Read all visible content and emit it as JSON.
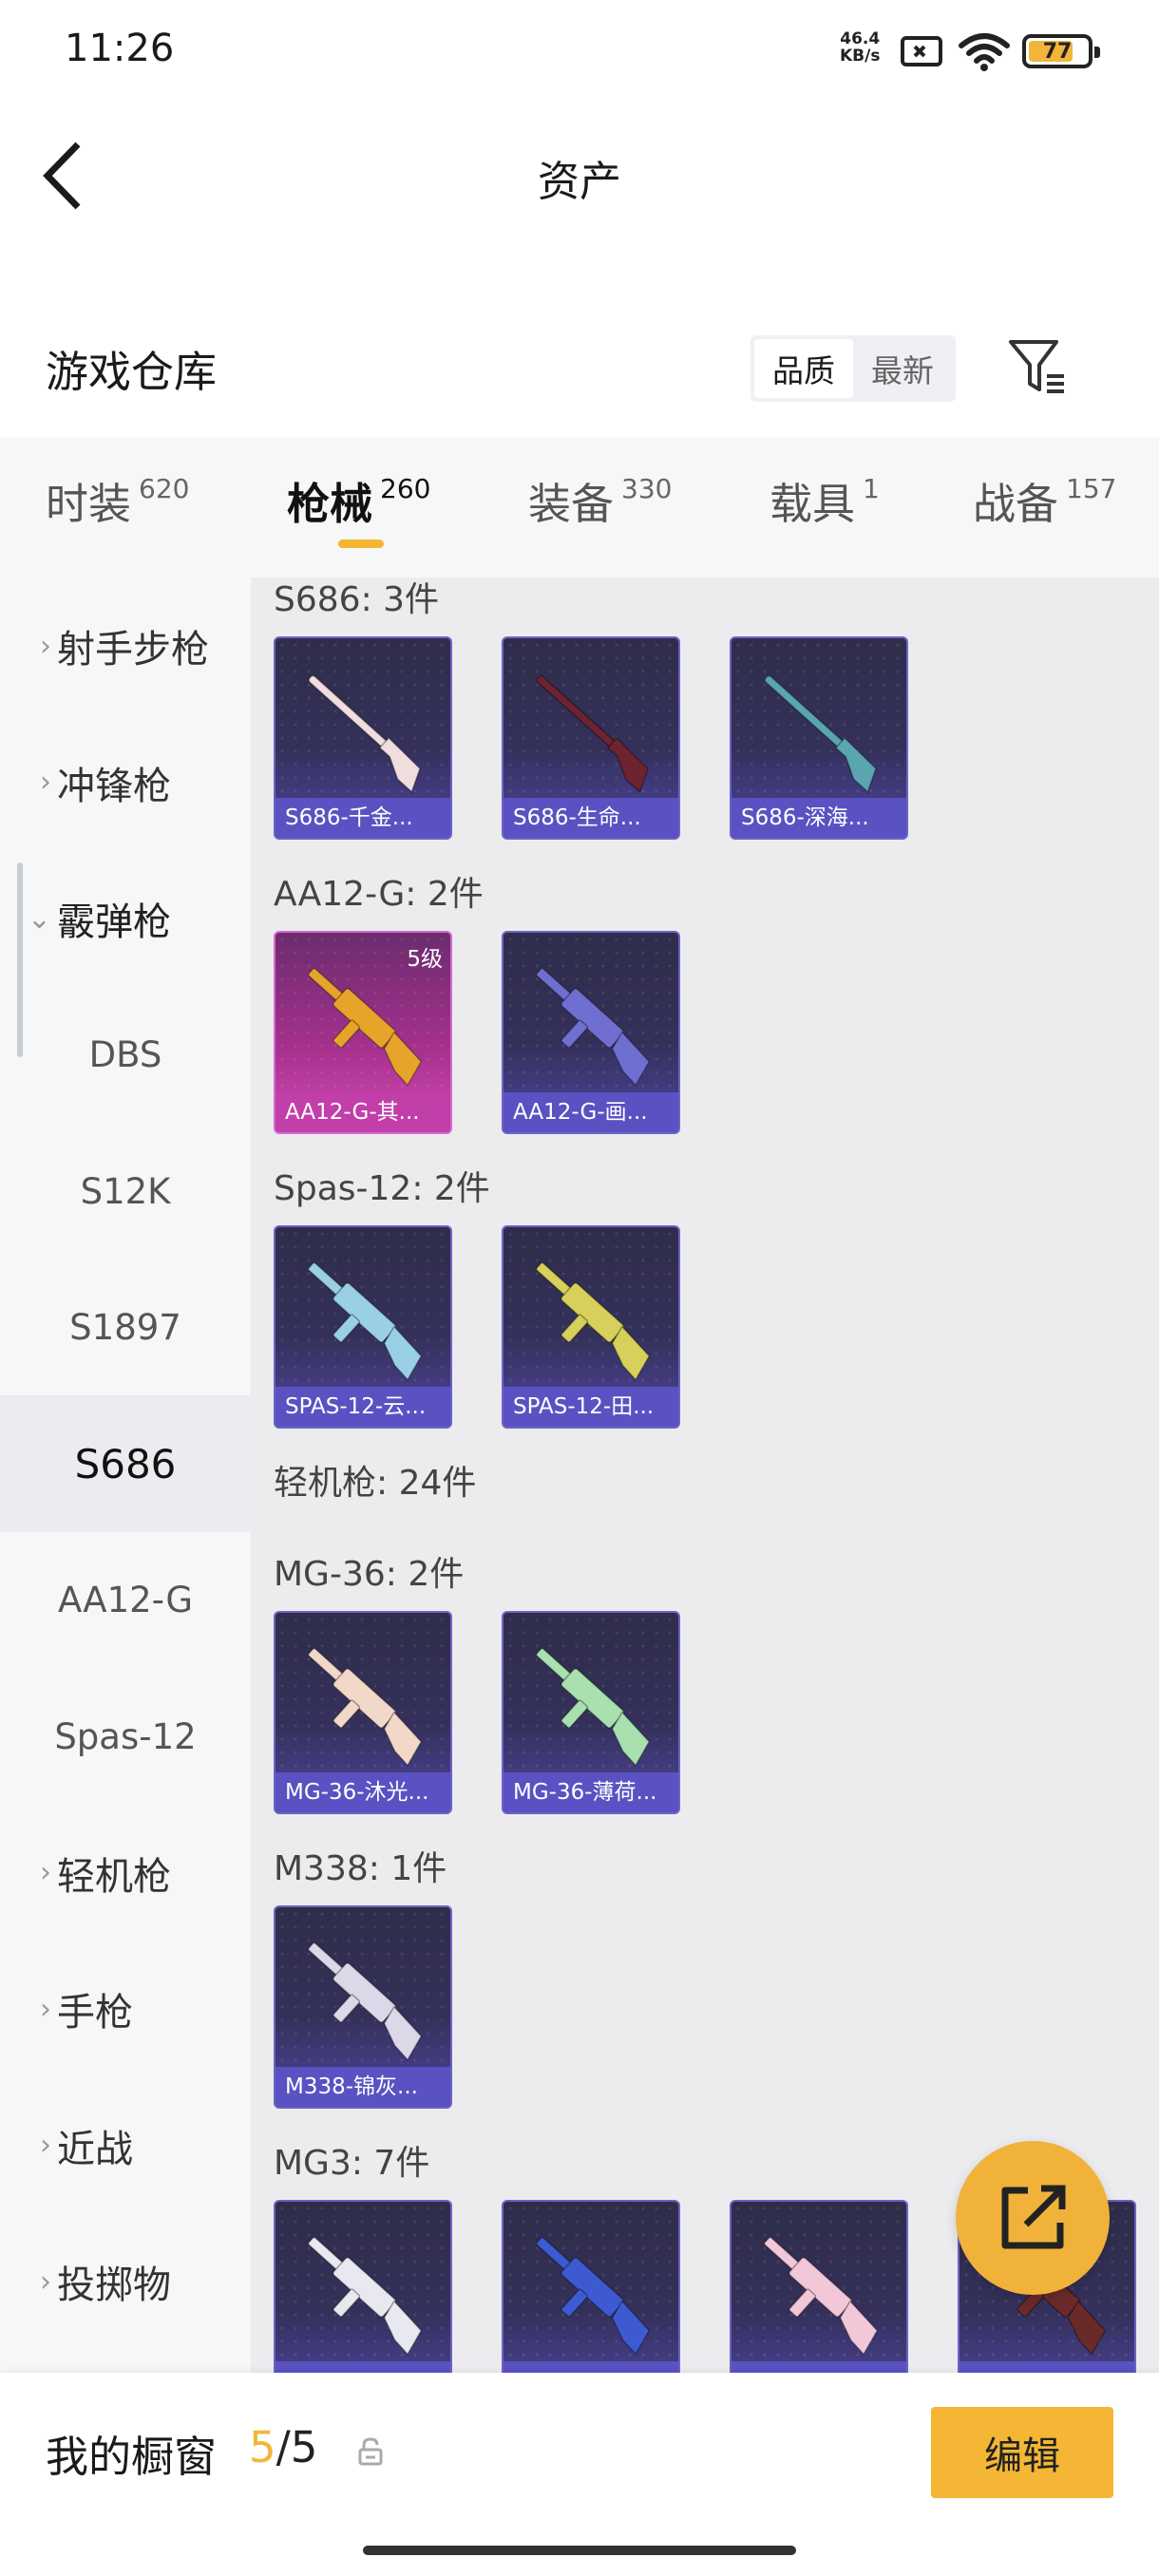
{
  "status": {
    "time": "11:26",
    "speed_value": "46.4",
    "speed_unit": "KB/s",
    "battery": "77",
    "battery_level": 0.77
  },
  "header": {
    "title": "资产"
  },
  "warehouse": {
    "title": "游戏仓库",
    "sort_options": [
      "品质",
      "最新"
    ],
    "active_sort": "品质"
  },
  "tabs": [
    {
      "label": "时装",
      "count": "620"
    },
    {
      "label": "枪械",
      "count": "260",
      "active": true
    },
    {
      "label": "装备",
      "count": "330"
    },
    {
      "label": "载具",
      "count": "1"
    },
    {
      "label": "战备",
      "count": "157"
    }
  ],
  "sidebar": [
    {
      "label": "射手步枪",
      "type": "category"
    },
    {
      "label": "冲锋枪",
      "type": "category"
    },
    {
      "label": "霰弹枪",
      "type": "category",
      "expanded": true
    },
    {
      "label": "DBS",
      "type": "sub"
    },
    {
      "label": "S12K",
      "type": "sub"
    },
    {
      "label": "S1897",
      "type": "sub"
    },
    {
      "label": "S686",
      "type": "sub",
      "selected": true
    },
    {
      "label": "AA12-G",
      "type": "sub"
    },
    {
      "label": "Spas-12",
      "type": "sub"
    },
    {
      "label": "轻机枪",
      "type": "category"
    },
    {
      "label": "手枪",
      "type": "category"
    },
    {
      "label": "近战",
      "type": "category"
    },
    {
      "label": "投掷物",
      "type": "category"
    }
  ],
  "groups": [
    {
      "title": "S686: 3件",
      "items": [
        {
          "name": "S686-千金...",
          "rarity": "epic",
          "gun_color": "#f0dede"
        },
        {
          "name": "S686-生命...",
          "rarity": "epic",
          "gun_color": "#6b2430"
        },
        {
          "name": "S686-深海...",
          "rarity": "epic",
          "gun_color": "#5aa5b0"
        }
      ]
    },
    {
      "title": "AA12-G: 2件",
      "items": [
        {
          "name": "AA12-G-其...",
          "rarity": "legendary",
          "level": "5级",
          "gun_color": "#e6a52a"
        },
        {
          "name": "AA12-G-画...",
          "rarity": "epic",
          "gun_color": "#6e6fd0"
        }
      ]
    },
    {
      "title": "Spas-12: 2件",
      "items": [
        {
          "name": "SPAS-12-云...",
          "rarity": "epic",
          "gun_color": "#9ad0e6"
        },
        {
          "name": "SPAS-12-田...",
          "rarity": "epic",
          "gun_color": "#d7d05a"
        }
      ]
    },
    {
      "title": "轻机枪: 24件",
      "items": []
    },
    {
      "title": "MG-36: 2件",
      "items": [
        {
          "name": "MG-36-沐光...",
          "rarity": "epic",
          "gun_color": "#f2d8c8"
        },
        {
          "name": "MG-36-薄荷...",
          "rarity": "epic",
          "gun_color": "#a8e0b0"
        }
      ]
    },
    {
      "title": "M338: 1件",
      "items": [
        {
          "name": "M338-锦灰...",
          "rarity": "epic",
          "gun_color": "#ddd8e8"
        }
      ]
    },
    {
      "title": "MG3: 7件",
      "items": [
        {
          "name": "",
          "rarity": "epic",
          "gun_color": "#e8e8f0"
        },
        {
          "name": "",
          "rarity": "epic",
          "gun_color": "#3d5ad0"
        },
        {
          "name": "",
          "rarity": "epic",
          "gun_color": "#f2c8d8"
        },
        {
          "name": "",
          "rarity": "epic",
          "gun_color": "#6a2a2a"
        }
      ]
    }
  ],
  "showcase": {
    "title": "我的橱窗",
    "current": "5",
    "total": "/5",
    "edit_label": "编辑"
  },
  "colors": {
    "accent": "#f3b631",
    "card_epic": "#5a52c2",
    "card_legendary": "#c23ea8"
  }
}
